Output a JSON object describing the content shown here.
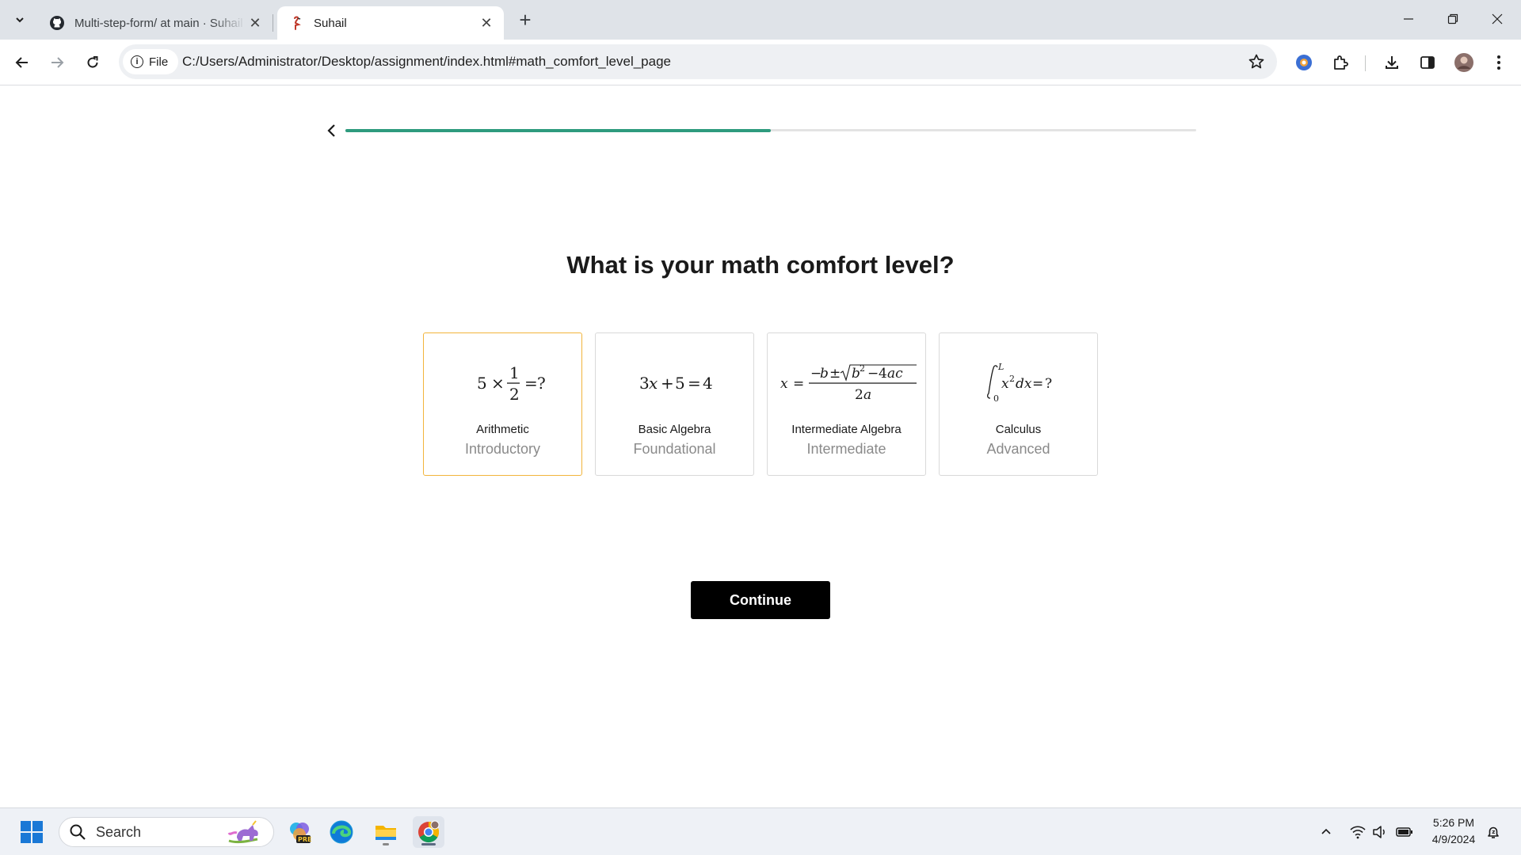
{
  "browser": {
    "tabs": [
      {
        "title": "Multi-step-form/ at main · Suhail",
        "active": false,
        "favicon": "github-icon"
      },
      {
        "title": "Suhail",
        "active": true,
        "favicon": "flamingo-icon"
      }
    ],
    "address_chip": "File",
    "url": "C:/Users/Administrator/Desktop/assignment/index.html#math_comfort_level_page"
  },
  "page": {
    "progress": 0.5,
    "question": "What is your math comfort level?",
    "options": [
      {
        "label": "Arithmetic",
        "level": "Introductory",
        "selected": true
      },
      {
        "label": "Basic Algebra",
        "level": "Foundational",
        "selected": false
      },
      {
        "label": "Intermediate Algebra",
        "level": "Intermediate",
        "selected": false
      },
      {
        "label": "Calculus",
        "level": "Advanced",
        "selected": false
      }
    ],
    "continue_label": "Continue"
  },
  "taskbar": {
    "search_label": "Search",
    "time": "5:26 PM",
    "date": "4/9/2024"
  },
  "colors": {
    "progress": "#2e9b7e",
    "selected_border": "#f2b43b",
    "button": "#000000"
  }
}
